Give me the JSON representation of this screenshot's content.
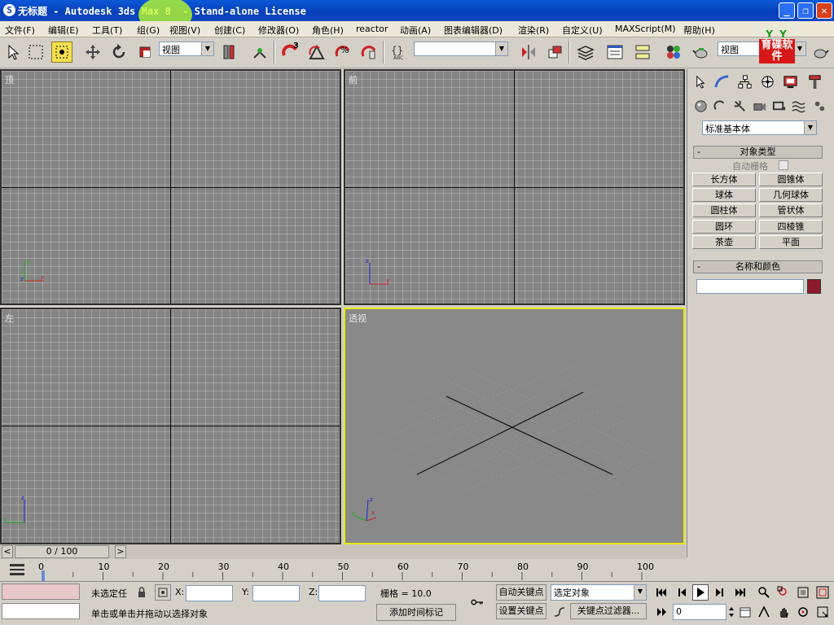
{
  "window": {
    "icon_letter": "S",
    "title": "无标题 - Autodesk 3ds Max 8  - Stand-alone License",
    "min_label": "_",
    "max_label": "❐",
    "close_label": "✕"
  },
  "menu": {
    "items": [
      "文件(F)",
      "编辑(E)",
      "工具(T)",
      "组(G)",
      "视图(V)",
      "创建(C)",
      "修改器(O)",
      "角色(H)",
      "reactor",
      "动画(A)",
      "图表编辑器(D)",
      "渲染(R)",
      "自定义(U)",
      "MAXScript(M)",
      "帮助(H)"
    ]
  },
  "toolbar": {
    "view_select": "视图",
    "named_selection": "",
    "view_right": "视图",
    "logo_top": "Y Y",
    "logo_text": "育碟软件",
    "snap_num": "3"
  },
  "viewports": {
    "top_label": "顶",
    "front_label": "前",
    "left_label": "左",
    "persp_label": "透视"
  },
  "command_panel": {
    "category_select": "标准基本体",
    "object_type_header": "对象类型",
    "rollout_marker": "-",
    "autogrid_label": "自动栅格",
    "buttons": [
      "长方体",
      "圆锥体",
      "球体",
      "几何球体",
      "圆柱体",
      "管状体",
      "圆环",
      "四棱锥",
      "茶壶",
      "平面"
    ],
    "name_color_header": "名称和颜色",
    "name_value": "",
    "color_swatch": "#8b1a2a"
  },
  "time": {
    "slider_text": "0 / 100",
    "prev_arrow": "<",
    "next_arrow": ">",
    "ticks": [
      "0",
      "10",
      "20",
      "30",
      "40",
      "50",
      "60",
      "70",
      "80",
      "90",
      "100"
    ]
  },
  "status": {
    "selection_text": "未选定任",
    "x_label": "X:",
    "y_label": "Y:",
    "z_label": "Z:",
    "x_value": "",
    "y_value": "",
    "z_value": "",
    "grid_text": "栅格 = 10.0",
    "prompt_text": "单击或单击并拖动以选择对象",
    "add_time_tag": "添加时间标记",
    "autokey": "自动关键点",
    "setkey": "设置关键点",
    "selected_objects": "选定对象",
    "key_filters": "关键点过滤器...",
    "frame_value": "0"
  }
}
